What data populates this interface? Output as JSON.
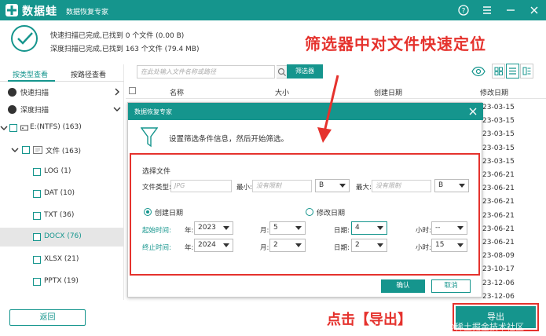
{
  "app": {
    "brand": "数据蛙",
    "subtitle": "数据恢复专家"
  },
  "status": {
    "quick_scan": "快速扫描已完成,已找到 0 个文件 (0.00  B)",
    "deep_scan": "深度扫描已完成,已找到 163 个文件 (79.4 MB)"
  },
  "annotations": {
    "headline": "筛选器中对文件快速定位",
    "bottom_caption": "点击【导出】",
    "watermark": "@稀土掘金技术社区"
  },
  "left_panel": {
    "tab_type": "按类型查看",
    "tab_path": "按路径查看",
    "quick_scan": "快速扫描",
    "deep_scan": "深度扫描",
    "drive": "E:(NTFS) (163)",
    "folder": "文件 (163)",
    "types": [
      "LOG (1)",
      "DAT (10)",
      "TXT (36)",
      "DOCX (76)",
      "XLSX (21)",
      "PPTX (19)"
    ]
  },
  "toolbar": {
    "search_placeholder": "在此处输入文件名称或路径",
    "filter_label": "筛选器"
  },
  "table": {
    "col_name": "名称",
    "col_size": "大小",
    "col_created": "创建日期",
    "col_modified": "修改日期",
    "dates": [
      "23-03-15",
      "23-03-15",
      "23-03-15",
      "23-03-15",
      "23-03-15",
      "23-06-21",
      "23-06-21",
      "23-06-21",
      "23-06-21",
      "23-06-21",
      "23-06-21",
      "23-08-09",
      "23-10-17",
      "23-12-06",
      "23-12-06"
    ]
  },
  "dialog": {
    "title": "数据恢复专家",
    "hint": "设置筛选条件信息，然后开始筛选。",
    "section": "选择文件",
    "file_type_label": "文件类型:",
    "file_type_placeholder": "JPG",
    "min_label": "最小:",
    "min_placeholder": "没有限制",
    "min_unit": "B",
    "max_label": "最大:",
    "max_placeholder": "没有限制",
    "max_unit": "B",
    "created_label": "创建日期",
    "modified_label": "修改日期",
    "start_label": "起始时间:",
    "end_label": "终止时间:",
    "year_label": "年:",
    "month_label": "月:",
    "day_label": "日期:",
    "hour_label": "小时:",
    "start_year": "2023",
    "start_month": "5",
    "start_day": "4",
    "start_hour": "--",
    "end_year": "2024",
    "end_month": "2",
    "end_day": "2",
    "end_hour": "15",
    "ok": "确认",
    "cancel": "取消"
  },
  "buttons": {
    "back": "返回",
    "export": "导出"
  },
  "colors": {
    "accent": "#15958d",
    "highlight": "#e5322d"
  }
}
